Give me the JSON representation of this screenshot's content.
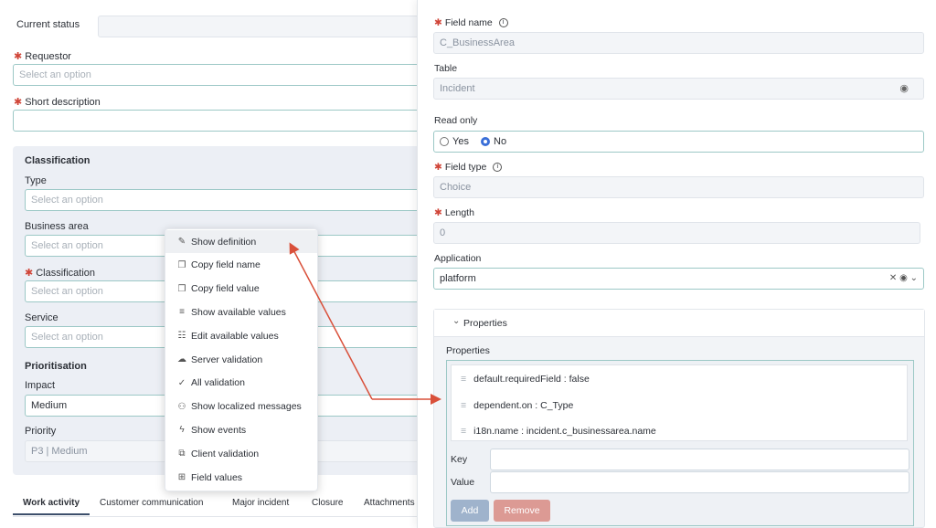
{
  "left": {
    "current_status": {
      "label": "Current status",
      "value": ""
    },
    "requestor": {
      "label": "Requestor",
      "placeholder": "Select an option"
    },
    "short_description": {
      "label": "Short description",
      "value": ""
    },
    "classification_section": "Classification",
    "type": {
      "label": "Type",
      "placeholder": "Select an option"
    },
    "business_area": {
      "label": "Business area",
      "placeholder": "Select an option"
    },
    "classification": {
      "label": "Classification",
      "placeholder": "Select an option"
    },
    "service": {
      "label": "Service",
      "placeholder": "Select an option"
    },
    "prioritisation_section": "Prioritisation",
    "impact": {
      "label": "Impact",
      "value": "Medium"
    },
    "priority": {
      "label": "Priority",
      "value": "P3 | Medium"
    },
    "tabs": [
      "Work activity",
      "Customer communication",
      "Major incident",
      "Closure",
      "Attachments"
    ]
  },
  "context_menu": {
    "items": [
      {
        "label": "Show definition",
        "icon": "pencil-icon"
      },
      {
        "label": "Copy field name",
        "icon": "copy-icon"
      },
      {
        "label": "Copy field value",
        "icon": "copy-icon"
      },
      {
        "label": "Show available values",
        "icon": "list-icon"
      },
      {
        "label": "Edit available values",
        "icon": "edit-list-icon"
      },
      {
        "label": "Server validation",
        "icon": "cloud-icon"
      },
      {
        "label": "All validation",
        "icon": "check-icon"
      },
      {
        "label": "Show localized messages",
        "icon": "people-icon"
      },
      {
        "label": "Show events",
        "icon": "lightning-icon"
      },
      {
        "label": "Client validation",
        "icon": "external-icon"
      },
      {
        "label": "Field values",
        "icon": "grid-icon"
      }
    ]
  },
  "right": {
    "field_name": {
      "label": "Field name",
      "value": "C_BusinessArea"
    },
    "table": {
      "label": "Table",
      "value": "Incident"
    },
    "read_only": {
      "label": "Read only",
      "yes": "Yes",
      "no": "No"
    },
    "field_type": {
      "label": "Field type",
      "value": "Choice"
    },
    "length": {
      "label": "Length",
      "value": "0"
    },
    "application": {
      "label": "Application",
      "value": "platform"
    },
    "properties_header": "Properties",
    "properties_label": "Properties",
    "properties": [
      "default.requiredField : false",
      "dependent.on : C_Type",
      "i18n.name : incident.c_businessarea.name"
    ],
    "key_label": "Key",
    "value_label": "Value",
    "add_button": "Add",
    "remove_button": "Remove"
  },
  "colors": {
    "accent": "#d04437",
    "teal_border": "#9cc8c6",
    "add_button": "#9fb3cc",
    "remove_button": "#dc9a94",
    "arrow": "#d9503a"
  }
}
